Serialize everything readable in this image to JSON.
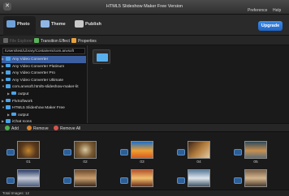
{
  "window": {
    "title": "HTML5 Slideshow Maker Free Version"
  },
  "menu": {
    "preference": "Preference",
    "help": "Help"
  },
  "tabs": [
    {
      "label": "Photo",
      "icon": "photo-icon",
      "color": "#6fa2d8"
    },
    {
      "label": "Theme",
      "icon": "theme-icon",
      "color": "#8fb7e6"
    },
    {
      "label": "Publish",
      "icon": "publish-icon",
      "color": "#c9c9c9"
    }
  ],
  "upgrade_label": "Upgrade",
  "toolbar": {
    "file_explorer": "File Explorer",
    "transition_effect": "Transition Effect",
    "properties": "Properties"
  },
  "path": "/Users/test/Library/Containers/com.anvsoft",
  "tree": [
    {
      "label": "Any Video Converter",
      "selected": true
    },
    {
      "label": "Any Video Converter Platinum"
    },
    {
      "label": "Any Video Converter Pro"
    },
    {
      "label": "Any Video Converter Ultimate"
    },
    {
      "label": "com.anvsoft.html5-slideshow-maker-lit"
    },
    {
      "label": "output",
      "indent": true
    },
    {
      "label": "FlvSoftwork"
    },
    {
      "label": "HTML5 Slideshow Maker Free"
    },
    {
      "label": "output",
      "indent": true
    },
    {
      "label": "iChat Icons"
    }
  ],
  "folder_view": {
    "label": ".."
  },
  "actions": {
    "add": "Add",
    "remove": "Remove",
    "remove_all": "Remove All"
  },
  "thumbnails": [
    {
      "caption": "01",
      "colors": [
        "#5b3a1e",
        "#c0862e",
        "#3a2a14"
      ]
    },
    {
      "caption": "02",
      "colors": [
        "#7a5a34",
        "#d8c8a0",
        "#4e3b20"
      ]
    },
    {
      "caption": "03",
      "colors": [
        "#1e6fc5",
        "#f0a030",
        "#d65a22"
      ]
    },
    {
      "caption": "04",
      "colors": [
        "#3a2418",
        "#b07b3c",
        "#e4c9a0"
      ]
    },
    {
      "caption": "05",
      "colors": [
        "#2e4a5a",
        "#c99050",
        "#5b6b76"
      ]
    },
    {
      "caption": "",
      "colors": [
        "#2c3d6a",
        "#c7ccd6",
        "#4a5c80"
      ]
    },
    {
      "caption": "",
      "colors": [
        "#6d4a2c",
        "#caa070",
        "#3a2819"
      ]
    },
    {
      "caption": "",
      "colors": [
        "#b5542b",
        "#f2c070",
        "#6b2e18"
      ]
    },
    {
      "caption": "",
      "colors": [
        "#5a7c9a",
        "#e0e6ec",
        "#3c5468"
      ]
    },
    {
      "caption": "",
      "colors": [
        "#7b6148",
        "#d4b690",
        "#4a3a2a"
      ]
    }
  ],
  "status": {
    "total_images": "Total Images: 12"
  },
  "colors": {
    "selection": "#3c5fa0",
    "accent": "#2a79db",
    "folder": "#4aa3e8"
  }
}
